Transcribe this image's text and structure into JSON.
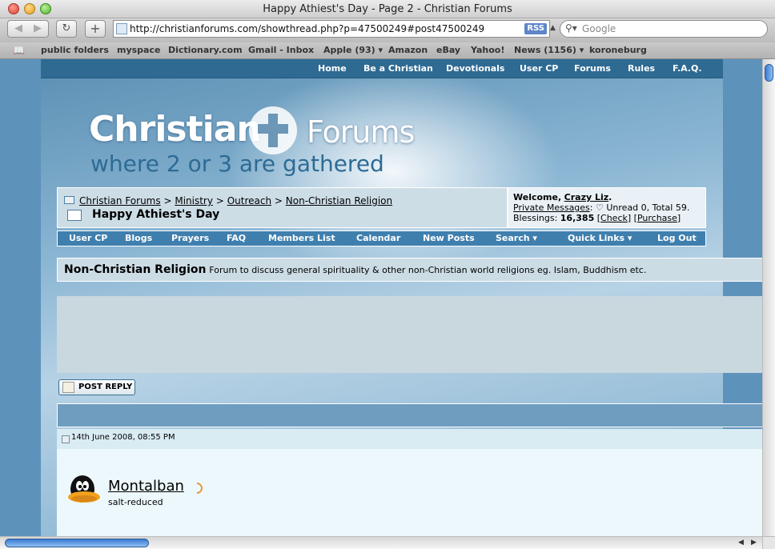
{
  "window": {
    "title": "Happy Athiest's Day - Page 2 - Christian Forums"
  },
  "toolbar": {
    "url": "http://christianforums.com/showthread.php?p=47500249#post47500249",
    "rss_label": "RSS",
    "search_placeholder": "Google"
  },
  "bookmarks": [
    {
      "label": "public folders"
    },
    {
      "label": "myspace"
    },
    {
      "label": "Dictionary.com"
    },
    {
      "label": "Gmail - Inbox"
    },
    {
      "label": "Apple (93) ▾"
    },
    {
      "label": "Amazon"
    },
    {
      "label": "eBay"
    },
    {
      "label": "Yahoo!"
    },
    {
      "label": "News (1156) ▾"
    },
    {
      "label": "koroneburg"
    }
  ],
  "topnav": [
    {
      "label": "Home"
    },
    {
      "label": "Be a Christian"
    },
    {
      "label": "Devotionals"
    },
    {
      "label": "User CP"
    },
    {
      "label": "Forums"
    },
    {
      "label": "Rules"
    },
    {
      "label": "F.A.Q."
    }
  ],
  "logo": {
    "title": "Christian",
    "forums": "Forums",
    "tagline": "where 2 or 3 are gathered"
  },
  "breadcrumb": {
    "links": [
      "Christian Forums",
      "Ministry",
      "Outreach",
      "Non-Christian Religion"
    ],
    "separator": ">",
    "thread_title": "Happy Athiest's Day"
  },
  "welcome": {
    "greeting": "Welcome,",
    "username": "Crazy Liz",
    "pm_label": "Private Messages",
    "pm_status": "Unread 0, Total 59.",
    "blessings_label": "Blessings:",
    "blessings_value": "16,385",
    "check_label": "Check",
    "purchase_label": "Purchase"
  },
  "navbar": [
    {
      "label": "User CP"
    },
    {
      "label": "Blogs"
    },
    {
      "label": "Prayers"
    },
    {
      "label": "FAQ"
    },
    {
      "label": "Members List"
    },
    {
      "label": "Calendar"
    },
    {
      "label": "New Posts"
    },
    {
      "label": "Search ▾"
    },
    {
      "label": "Quick Links ▾"
    },
    {
      "label": "Log Out"
    }
  ],
  "forum": {
    "name": "Non-Christian Religion",
    "description": "Forum to discuss general spirituality & other non-Christian world religions eg. Islam, Buddhism etc."
  },
  "post": {
    "reply_button": "POST REPLY",
    "date": "14th June 2008, 08:55 PM",
    "username": "Montalban",
    "user_title": "salt-reduced"
  }
}
